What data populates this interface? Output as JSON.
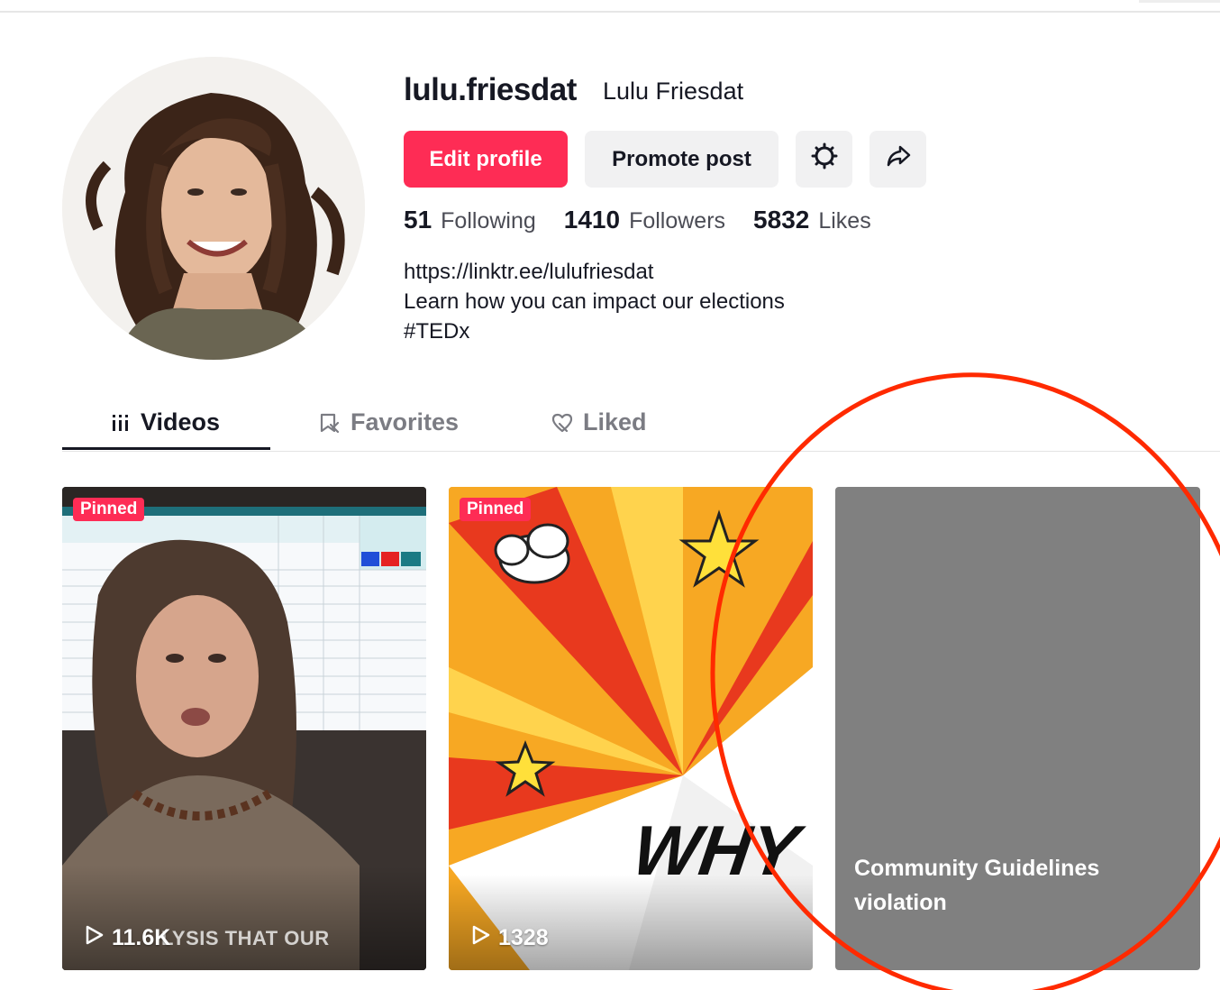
{
  "profile": {
    "handle": "lulu.friesdat",
    "display_name": "Lulu Friesdat",
    "avatar_alt": "Profile photo of Lulu Friesdat"
  },
  "actions": {
    "edit_profile": "Edit profile",
    "promote_post": "Promote post",
    "settings_icon": "gear-icon",
    "share_icon": "share-arrow-icon"
  },
  "stats": [
    {
      "value": "51",
      "label": "Following"
    },
    {
      "value": "1410",
      "label": "Followers"
    },
    {
      "value": "5832",
      "label": "Likes"
    }
  ],
  "bio": {
    "link": "https://linktr.ee/lulufriesdat",
    "line1": "Learn how you can impact our elections",
    "line2": "#TEDx"
  },
  "tabs": [
    {
      "label": "Videos",
      "icon": "grid-bars-icon",
      "active": true
    },
    {
      "label": "Favorites",
      "icon": "bookmark-icon",
      "active": false
    },
    {
      "label": "Liked",
      "icon": "heart-outline-icon",
      "active": false
    }
  ],
  "videos": [
    {
      "pinned_label": "Pinned",
      "views": "11.6K",
      "overlay_text": "LYSIS THAT OUR"
    },
    {
      "pinned_label": "Pinned",
      "views": "1328",
      "overlay_text": "WHY"
    },
    {
      "status": "Community Guidelines violation"
    }
  ],
  "colors": {
    "brand": "#fe2c55",
    "annotation": "#ff2a00",
    "violation_bg": "#808080"
  }
}
